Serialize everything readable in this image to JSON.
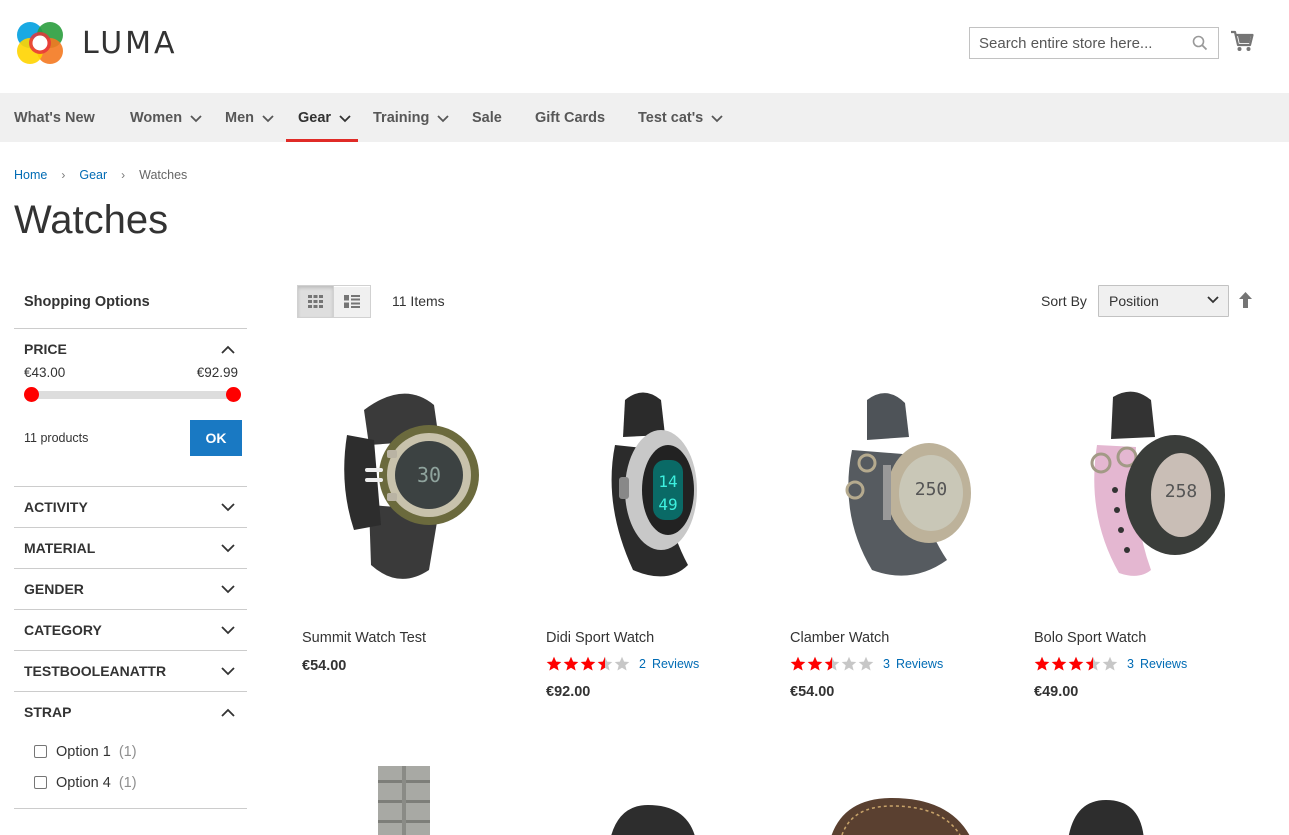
{
  "header": {
    "logo_text": "LUMA",
    "search_placeholder": "Search entire store here..."
  },
  "nav": [
    {
      "label": "What's New",
      "has_menu": false
    },
    {
      "label": "Women",
      "has_menu": true
    },
    {
      "label": "Men",
      "has_menu": true
    },
    {
      "label": "Gear",
      "has_menu": true,
      "active": true
    },
    {
      "label": "Training",
      "has_menu": true
    },
    {
      "label": "Sale",
      "has_menu": false
    },
    {
      "label": "Gift Cards",
      "has_menu": false
    },
    {
      "label": "Test cat's",
      "has_menu": true
    }
  ],
  "breadcrumb": {
    "home": "Home",
    "gear": "Gear",
    "current": "Watches",
    "separator": "›"
  },
  "page_title": "Watches",
  "sidebar": {
    "title": "Shopping Options",
    "price": {
      "label": "PRICE",
      "min": "€43.00",
      "max": "€92.99",
      "count_text": "11 products",
      "ok_label": "OK",
      "range_low_fraction": 0.0,
      "range_high_fraction": 1.0
    },
    "filters": [
      "ACTIVITY",
      "MATERIAL",
      "GENDER",
      "CATEGORY",
      "TESTBOOLEANATTR"
    ],
    "strap": {
      "label": "STRAP",
      "options": [
        {
          "label": "Option 1",
          "count": "(1)"
        },
        {
          "label": "Option 4",
          "count": "(1)"
        }
      ]
    }
  },
  "toolbar": {
    "items_count": "11 Items",
    "sort_label": "Sort By",
    "sort_value": "Position"
  },
  "products": [
    {
      "name": "Summit Watch Test",
      "price": "€54.00",
      "rating": null,
      "reviews_count": null,
      "reviews_label": null
    },
    {
      "name": "Didi Sport Watch",
      "price": "€92.00",
      "rating": 3.5,
      "reviews_count": "2",
      "reviews_label": "Reviews"
    },
    {
      "name": "Clamber Watch",
      "price": "€54.00",
      "rating": 2.5,
      "reviews_count": "3",
      "reviews_label": "Reviews"
    },
    {
      "name": "Bolo Sport Watch",
      "price": "€49.00",
      "rating": 3.5,
      "reviews_count": "3",
      "reviews_label": "Reviews"
    }
  ],
  "colors": {
    "accent_blue": "#1979c3",
    "link_blue": "#006bb4",
    "nav_active_red": "#e02b27",
    "star_red": "#ff0000",
    "slider_handle": "#ff0000"
  }
}
